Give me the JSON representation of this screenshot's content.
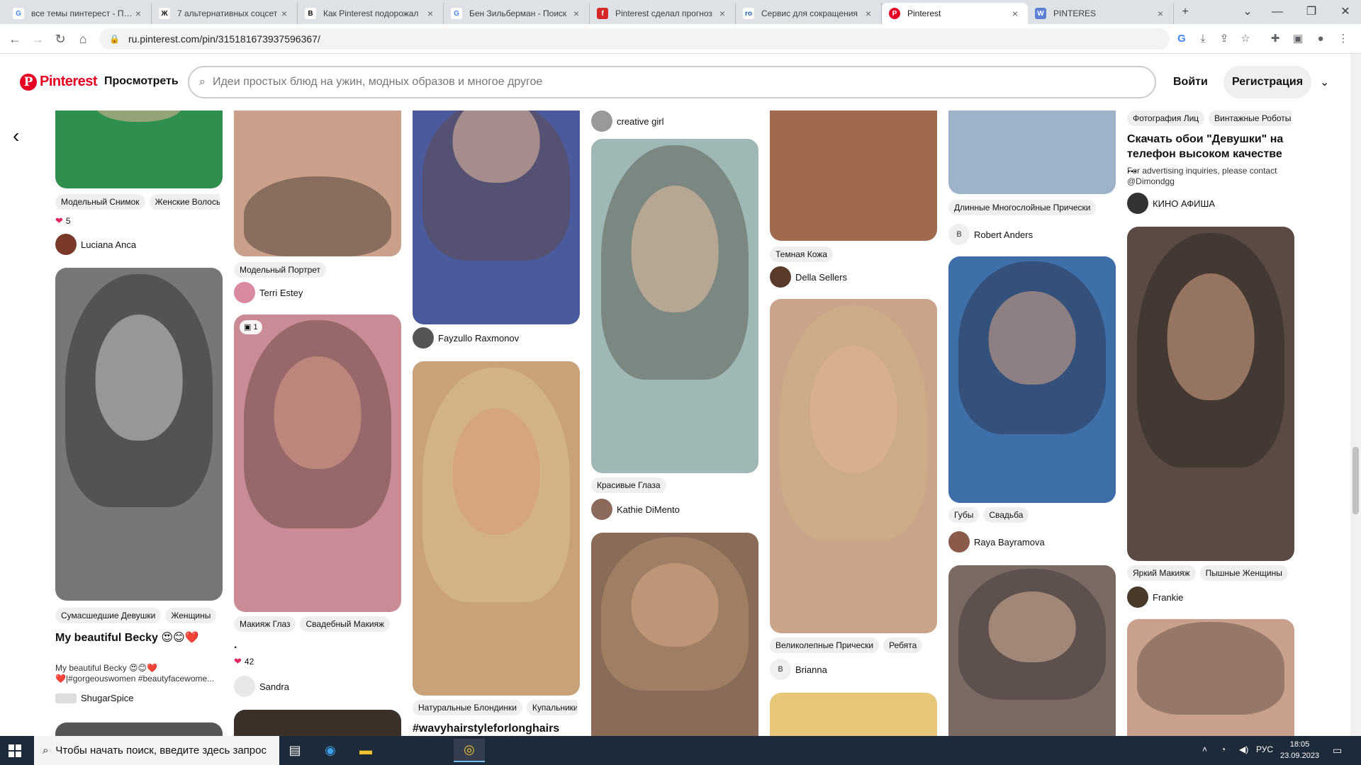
{
  "browser": {
    "tabs": [
      {
        "title": "все темы пинтерест - Пои",
        "icon": "G",
        "color": "#4285f4"
      },
      {
        "title": "7 альтернативных соцсет",
        "icon": "Ж",
        "color": "#111111"
      },
      {
        "title": "Как Pinterest подорожал",
        "icon": "B",
        "color": "#111111"
      },
      {
        "title": "Бен Зильберман - Поиск",
        "icon": "G",
        "color": "#4285f4"
      },
      {
        "title": "Pinterest сделал прогноз",
        "icon": "f",
        "color": "#d62828"
      },
      {
        "title": "Сервис для сокращения",
        "icon": "ro",
        "color": "#1a5fb4"
      },
      {
        "title": "Pinterest",
        "icon": "P",
        "color": "#e60023",
        "active": true
      },
      {
        "title": "PINTERES",
        "icon": "W",
        "color": "#5b7fd3"
      }
    ],
    "url": "ru.pinterest.com/pin/315181673937596367/"
  },
  "header": {
    "brand": "Pinterest",
    "explore": "Просмотреть",
    "search_placeholder": "Идеи простых блюд на ужин, модных образов и многое другое",
    "login": "Войти",
    "signup": "Регистрация"
  },
  "colors": {
    "brand": "#e60023",
    "tag_bg": "#efefef"
  },
  "columns": [
    {
      "pins": [
        {
          "tags": [
            "Модельный Снимок",
            "Женские Волосы"
          ],
          "reaction": "5",
          "author": "Luciana Anca",
          "tone": "#2f8f4e"
        },
        {
          "tags": [
            "Сумасшедшие Девушки",
            "Женщины"
          ],
          "title": "My beautiful Becky 😍😊❤️",
          "desc": "My beautiful Becky 😍😊❤️ ❤️|#gorgeouswomen #beautyfacewome...",
          "author": "ShugarSpice",
          "tone": "#777777"
        }
      ]
    },
    {
      "pins": [
        {
          "tags": [
            "Модельный Портрет"
          ],
          "author": "Terri Estey",
          "tone": "#caa08a"
        },
        {
          "badge": "1",
          "tags": [
            "Макияж Глаз",
            "Свадебный Макияж"
          ],
          "title": ".",
          "reaction": "42",
          "author": "Sandra",
          "tone": "#c98c96"
        }
      ]
    },
    {
      "pins": [
        {
          "author": "Fayzullo Raxmonov",
          "tone": "#4a5a9c"
        },
        {
          "tags": [
            "Натуральные Блондинки",
            "Купальники"
          ],
          "title": "#wavyhairstyleforlonghairs",
          "tone": "#c9a27a"
        }
      ]
    },
    {
      "pins": [
        {
          "author": "creative girl",
          "tone": "#bbbbbb"
        },
        {
          "tags": [
            "Красивые Глаза"
          ],
          "author": "Kathie DiMento",
          "tone": "#9fb8b6"
        },
        {
          "tone": "#8a6b58"
        }
      ]
    },
    {
      "pins": [
        {
          "tags": [
            "Темная Кожа"
          ],
          "author": "Della Sellers",
          "tone": "#a06a4e"
        },
        {
          "tags": [
            "Великолепные Прически",
            "Ребята"
          ],
          "author": "Brianna",
          "avatar_letter": "B",
          "tone": "#c9a488"
        },
        {
          "tone": "#e8c77a"
        }
      ]
    },
    {
      "pins": [
        {
          "tags": [
            "Длинные Многослойные Прически"
          ],
          "author": "Robert Anders",
          "avatar_letter": "B",
          "tone": "#9fb3c8"
        },
        {
          "tags": [
            "Губы",
            "Свадьба"
          ],
          "author": "Raya Bayramova",
          "tone": "#3f6fa8"
        },
        {
          "tone": "#7a6a64"
        }
      ]
    },
    {
      "pins": [
        {
          "tags": [
            "Фотография Лиц",
            "Винтажные Роботы"
          ],
          "title": "Скачать обои \"Девушки\" на телефон  высоком качестве ...",
          "desc": "For advertising inquiries, please contact @Dimondgg",
          "author": "КИНО АФИША",
          "tone": "#333333"
        },
        {
          "tags": [
            "Яркий Макияж",
            "Пышные Женщины"
          ],
          "author": "Frankie",
          "tone": "#5a4a44"
        },
        {
          "tone": "#c9a08e"
        }
      ]
    }
  ],
  "taskbar": {
    "search_placeholder": "Чтобы начать поиск, введите здесь запрос",
    "lang": "РУС",
    "time": "18:05",
    "date": "23.09.2023"
  }
}
